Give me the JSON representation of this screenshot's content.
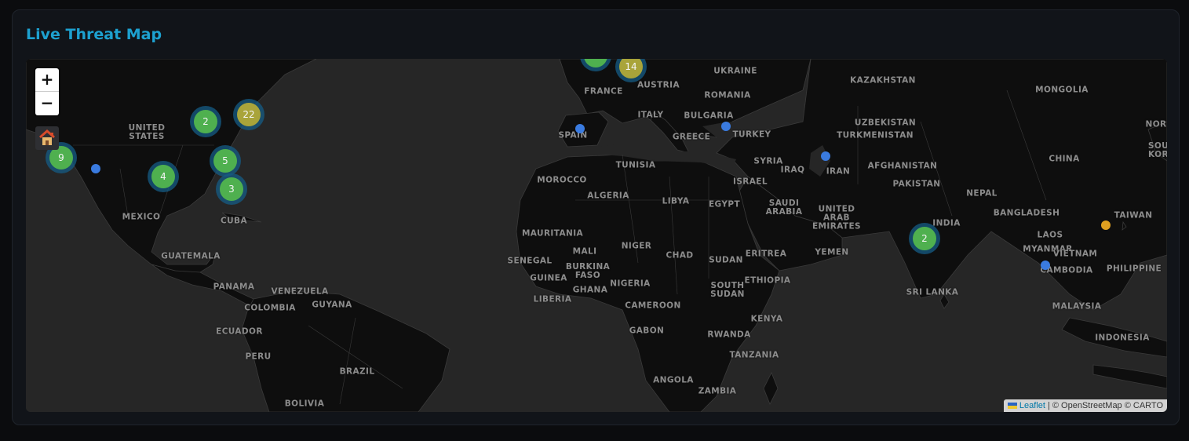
{
  "panel": {
    "title": "Live Threat Map"
  },
  "map": {
    "zoom_in": "+",
    "zoom_out": "−",
    "home_icon": "🏠",
    "countries": [
      "UKRAINE",
      "KAZAKHSTAN",
      "MONGOLIA",
      "AUSTRIA",
      "ROMANIA",
      "FRANCE",
      "ITALY",
      "BULGARIA",
      "UZBEKISTAN",
      "UNITED\nSTATES",
      "SPAIN",
      "GREECE",
      "TURKEY",
      "TURKMENISTAN",
      "NOR",
      "SOU\nKOR",
      "CHINA",
      "TUNISIA",
      "SYRIA",
      "IRAQ",
      "IRAN",
      "AFGHANISTAN",
      "MOROCCO",
      "ISRAEL",
      "PAKISTAN",
      "ALGERIA",
      "LIBYA",
      "EGYPT",
      "SAUDI\nARABIA",
      "NEPAL",
      "UNITED\nARAB\nEMIRATES",
      "MEXICO",
      "CUBA",
      "INDIA",
      "BANGLADESH",
      "TAIWAN",
      "MAURITANIA",
      "LAOS",
      "NIGER",
      "MALI",
      "CHAD",
      "SUDAN",
      "ERITREA",
      "YEMEN",
      "MYANMAR",
      "GUATEMALA",
      "SENEGAL",
      "VIETNAM",
      "CAMBODIA",
      "PHILIPPINE",
      "BURKINA\nFASO",
      "GUINEA",
      "NIGERIA",
      "ETHIOPIA",
      "PANAMA",
      "VENEZUELA",
      "GHANA",
      "SOUTH\nSUDAN",
      "GUYANA",
      "SRI LANKA",
      "LIBERIA",
      "COLOMBIA",
      "CAMEROON",
      "MALAYSIA",
      "KENYA",
      "ECUADOR",
      "GABON",
      "RWANDA",
      "INDONESIA",
      "PERU",
      "TANZANIA",
      "BRAZIL",
      "ANGOLA",
      "ZAMBIA",
      "BOLIVIA"
    ],
    "clusters": [
      {
        "count": "2",
        "level": "normal"
      },
      {
        "count": "14",
        "level": "high"
      },
      {
        "count": "2",
        "level": "normal"
      },
      {
        "count": "22",
        "level": "high"
      },
      {
        "count": "9",
        "level": "normal"
      },
      {
        "count": "5",
        "level": "normal"
      },
      {
        "count": "4",
        "level": "normal"
      },
      {
        "count": "3",
        "level": "normal"
      },
      {
        "count": "2",
        "level": "normal"
      }
    ],
    "point_colors": {
      "low": "#3a7be0",
      "medium": "#e0a020"
    },
    "attribution": {
      "link": "Leaflet",
      "text": " | © OpenStreetMap © CARTO"
    }
  }
}
